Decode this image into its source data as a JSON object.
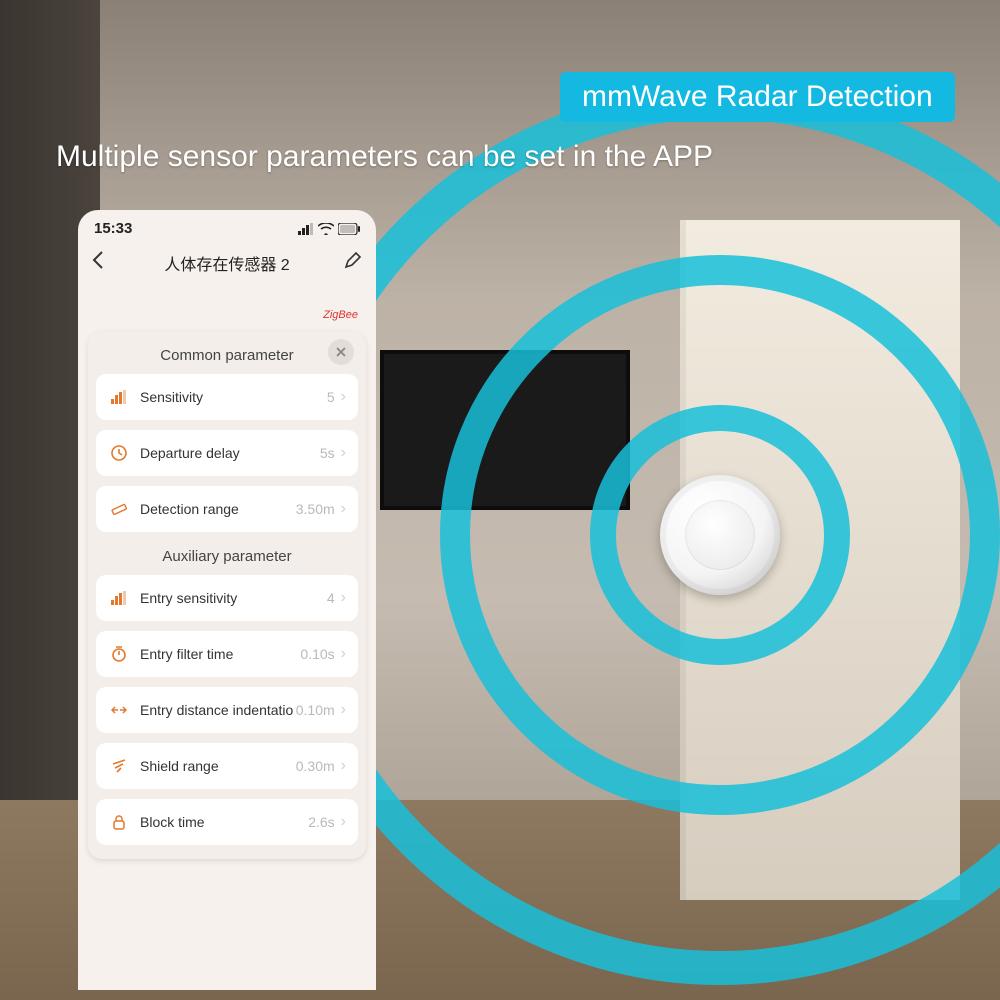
{
  "marketing": {
    "badge": "mmWave Radar Detection",
    "headline": "Multiple sensor parameters can be set in the APP"
  },
  "phone": {
    "status": {
      "time": "15:33"
    },
    "appbar": {
      "title": "人体存在传感器 2"
    },
    "protocol_badge": "ZigBee",
    "panel": {
      "common_header": "Common parameter",
      "aux_header": "Auxiliary parameter",
      "common": [
        {
          "icon": "bars",
          "label": "Sensitivity",
          "value": "5"
        },
        {
          "icon": "clock",
          "label": "Departure delay",
          "value": "5s"
        },
        {
          "icon": "ruler",
          "label": "Detection range",
          "value": "3.50m"
        }
      ],
      "aux": [
        {
          "icon": "bars",
          "label": "Entry sensitivity",
          "value": "4"
        },
        {
          "icon": "timer",
          "label": "Entry filter time",
          "value": "0.10s"
        },
        {
          "icon": "arrows",
          "label": "Entry distance indentatio",
          "value": "0.10m"
        },
        {
          "icon": "shield",
          "label": "Shield range",
          "value": "0.30m"
        },
        {
          "icon": "lock",
          "label": "Block time",
          "value": "2.6s"
        }
      ]
    }
  }
}
